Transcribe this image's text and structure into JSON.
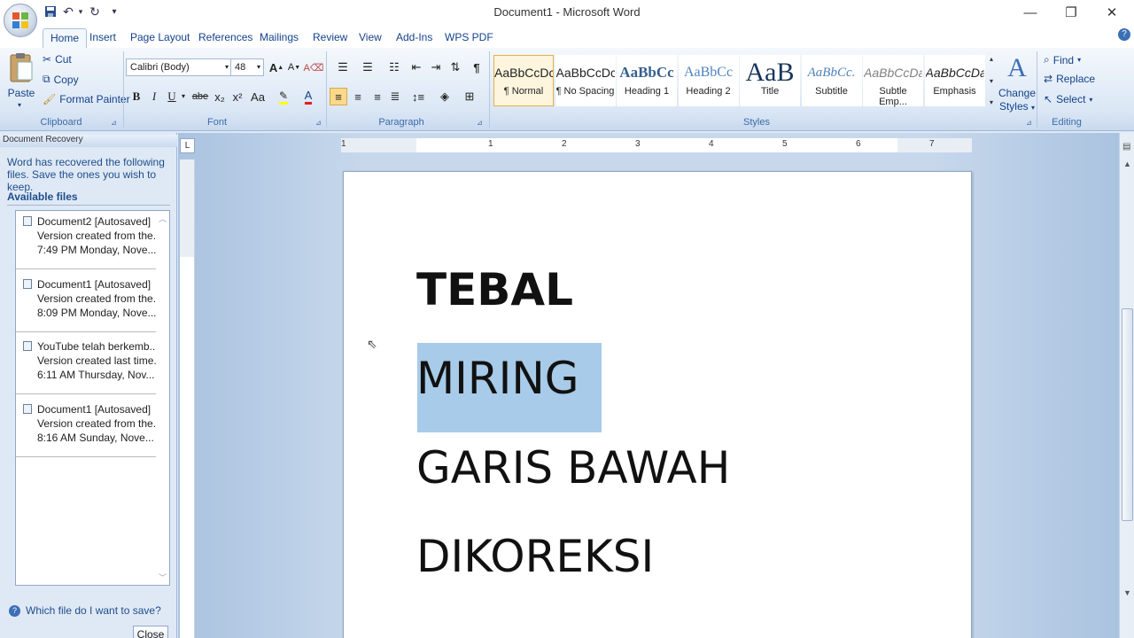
{
  "window": {
    "title": "Document1 - Microsoft Word",
    "minimize": "—",
    "restore": "❐",
    "close": "✕"
  },
  "qat": {
    "save": "💾",
    "undo": "↶",
    "redo": "↻",
    "customize": "▾"
  },
  "tabs": [
    "Home",
    "Insert",
    "Page Layout",
    "References",
    "Mailings",
    "Review",
    "View",
    "Add-Ins",
    "WPS PDF"
  ],
  "active_tab": "Home",
  "clipboard": {
    "paste": "Paste",
    "cut": "Cut",
    "copy": "Copy",
    "format_painter": "Format Painter",
    "label": "Clipboard"
  },
  "font": {
    "name": "Calibri (Body)",
    "size": "48",
    "label": "Font",
    "bold": "B",
    "italic": "I",
    "underline": "U",
    "strike": "abe",
    "subscript": "x₂",
    "superscript": "x²",
    "change_case": "Aa",
    "grow": "A",
    "shrink": "A"
  },
  "paragraph": {
    "label": "Paragraph"
  },
  "styles": {
    "label": "Styles",
    "items": [
      {
        "preview": "AaBbCcDc",
        "name": "¶ Normal",
        "selected": true
      },
      {
        "preview": "AaBbCcDc",
        "name": "¶ No Spacing"
      },
      {
        "preview": "AaBbCc",
        "name": "Heading 1"
      },
      {
        "preview": "AaBbCc",
        "name": "Heading 2"
      },
      {
        "preview": "AaB",
        "name": "Title"
      },
      {
        "preview": "AaBbCc.",
        "name": "Subtitle"
      },
      {
        "preview": "AaBbCcDa",
        "name": "Subtle Emp..."
      },
      {
        "preview": "AaBbCcDa",
        "name": "Emphasis"
      }
    ],
    "change_styles": "Change Styles"
  },
  "editing": {
    "find": "Find",
    "replace": "Replace",
    "select": "Select",
    "label": "Editing"
  },
  "recovery": {
    "header": "Document Recovery",
    "message": "Word has recovered the following files. Save the ones you wish to keep.",
    "available": "Available files",
    "files": [
      {
        "name": "Document2  [Autosaved]",
        "version": "Version created from the...",
        "time": "7:49 PM Monday, Nove..."
      },
      {
        "name": "Document1  [Autosaved]",
        "version": "Version created from the...",
        "time": "8:09 PM Monday, Nove..."
      },
      {
        "name": "YouTube telah berkemb...",
        "version": "Version created last time...",
        "time": "6:11 AM Thursday, Nov..."
      },
      {
        "name": "Document1  [Autosaved]",
        "version": "Version created from the...",
        "time": "8:16 AM Sunday, Nove..."
      }
    ],
    "help": "Which file do I want to save?",
    "close": "Close"
  },
  "ruler": {
    "numbers": [
      "1",
      "1",
      "2",
      "3",
      "4",
      "5",
      "6",
      "7"
    ],
    "tab_selector": "L"
  },
  "document": {
    "lines": [
      "TEBAL",
      "MIRING",
      "GARIS BAWAH",
      "DIKOREKSI"
    ]
  },
  "colors": {
    "accent": "#15428b",
    "selection": "#a7cbe8",
    "font_color": "#e02020",
    "highlight": "#ffff00"
  }
}
